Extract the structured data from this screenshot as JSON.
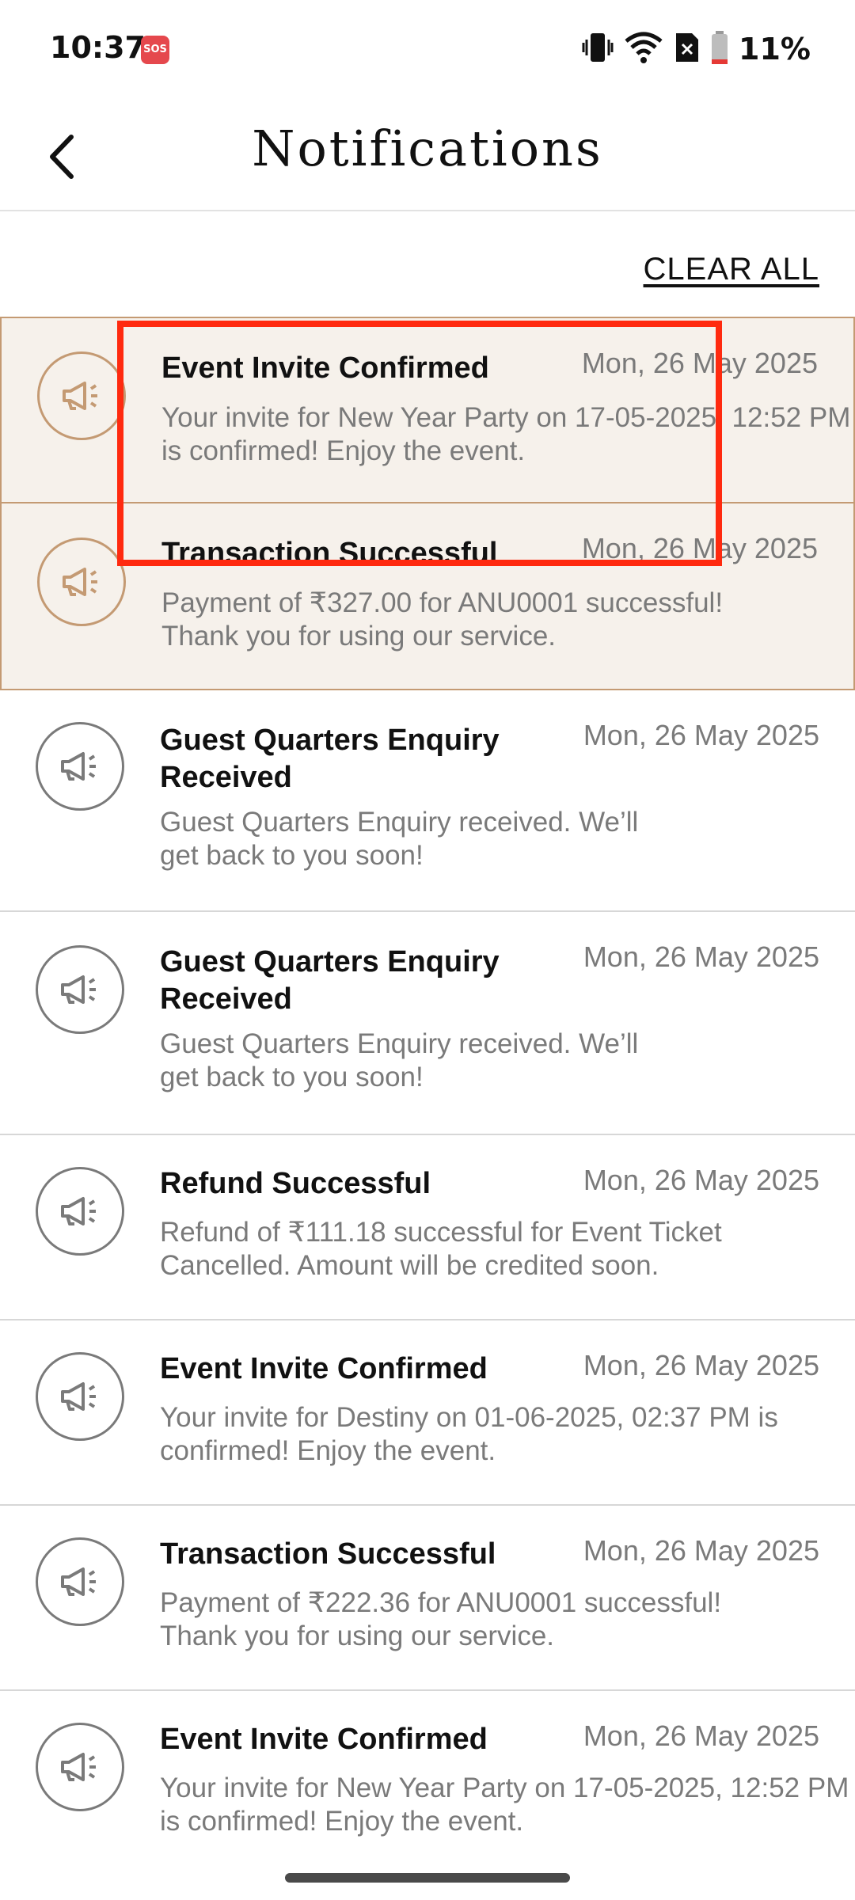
{
  "status_bar": {
    "time": "10:37",
    "sos": "SOS",
    "battery": "11%"
  },
  "header": {
    "title": "Notifications"
  },
  "actions": {
    "clear_all": "CLEAR ALL"
  },
  "notifications": [
    {
      "title": "Event Invite Confirmed",
      "date": "Mon, 26 May 2025",
      "body_lines": [
        "Your invite for New Year Party on 17-05-2025, 12:52 PM",
        "is confirmed! Enjoy the event."
      ],
      "unread": true
    },
    {
      "title": "Transaction Successful",
      "date": "Mon, 26 May 2025",
      "body_lines": [
        "Payment of ₹327.00 for ANU0001 successful!",
        "Thank you for using our service."
      ],
      "unread": true
    },
    {
      "title": "Guest Quarters Enquiry Received",
      "date": "Mon, 26 May 2025",
      "body_lines": [
        "Guest Quarters Enquiry received. We’ll",
        "get back to you soon!"
      ],
      "unread": false
    },
    {
      "title": "Guest Quarters Enquiry Received",
      "date": "Mon, 26 May 2025",
      "body_lines": [
        "Guest Quarters Enquiry received. We’ll",
        "get back to you soon!"
      ],
      "unread": false
    },
    {
      "title": "Refund Successful",
      "date": "Mon, 26 May 2025",
      "body_lines": [
        "Refund of ₹111.18 successful for Event Ticket",
        "Cancelled. Amount will be credited soon."
      ],
      "unread": false
    },
    {
      "title": "Event Invite Confirmed",
      "date": "Mon, 26 May 2025",
      "body_lines": [
        "Your invite for Destiny on 01-06-2025, 02:37 PM is",
        "confirmed! Enjoy the event."
      ],
      "unread": false
    },
    {
      "title": "Transaction Successful",
      "date": "Mon, 26 May 2025",
      "body_lines": [
        "Payment of ₹222.36 for ANU0001 successful!",
        "Thank you for using our service."
      ],
      "unread": false
    },
    {
      "title": "Event Invite Confirmed",
      "date": "Mon, 26 May 2025",
      "body_lines": [
        "Your invite for New Year Party on 17-05-2025, 12:52 PM",
        "is confirmed! Enjoy the event."
      ],
      "unread": false
    }
  ],
  "colors": {
    "unread_bg": "#f6f1eb",
    "accent": "#c49a73",
    "highlight": "#ff2a0f"
  },
  "icons": {
    "notification": "megaphone-icon",
    "back": "chevron-left-icon"
  }
}
